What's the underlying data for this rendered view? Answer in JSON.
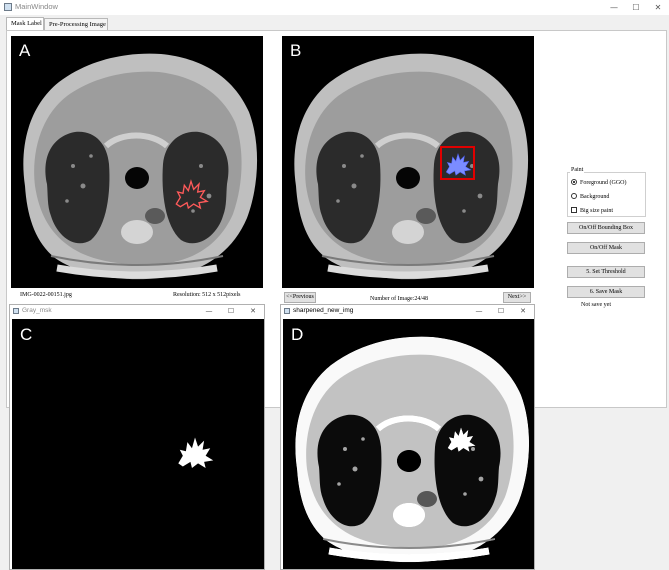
{
  "window": {
    "title": "MainWindow",
    "minimize_glyph": "—",
    "maximize_glyph": "☐",
    "close_glyph": "✕"
  },
  "tabs": [
    {
      "label": "Mask Label",
      "active": true
    },
    {
      "label": "Pre-Processing Image",
      "active": false
    }
  ],
  "panels": {
    "a": "A",
    "b": "B",
    "c": "C",
    "d": "D"
  },
  "image_info": {
    "filename": "IMG-0022-00151.jpg",
    "resolution": "Resolution: 512 x 512pixels",
    "count": "Number of Image:24/48"
  },
  "nav": {
    "previous": "<<Previous",
    "next": "Next>>"
  },
  "paint": {
    "title": "Paint",
    "foreground": "Foreground (GGO)",
    "background": "Background",
    "big_size": "Big size paint",
    "selected": "foreground",
    "big_size_checked": false
  },
  "actions": {
    "bounding_box": "On/Off Bounding Box",
    "mask": "On/Off Mask",
    "threshold": "5. Set Threshold",
    "save_mask": "6. Save Mask",
    "save_status": "Not save yet"
  },
  "subwindows": {
    "gray": {
      "title": "Gray_msk",
      "active": false
    },
    "sharpened": {
      "title": "sharpened_new_img",
      "active": true
    }
  },
  "colors": {
    "mask_overlay": "#7b8cff",
    "bounding_box": "#e00000",
    "contour": "#ff5a5a"
  }
}
